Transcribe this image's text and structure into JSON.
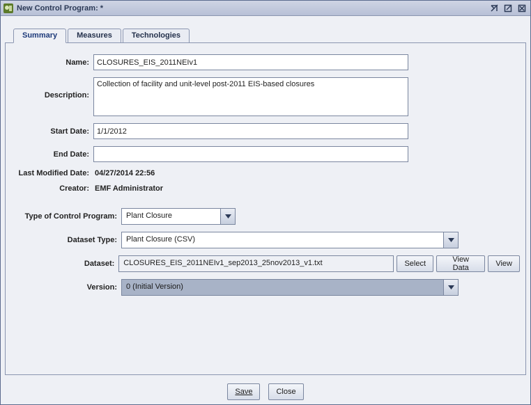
{
  "window": {
    "title": "New Control Program: *"
  },
  "tabs": [
    {
      "label": "Summary"
    },
    {
      "label": "Measures"
    },
    {
      "label": "Technologies"
    }
  ],
  "fields": {
    "name_label": "Name:",
    "name_value": "CLOSURES_EIS_2011NEIv1",
    "description_label": "Description:",
    "description_value": "Collection of facility and unit-level post-2011 EIS-based closures",
    "start_date_label": "Start Date:",
    "start_date_value": "1/1/2012",
    "end_date_label": "End Date:",
    "end_date_value": "",
    "last_mod_label": "Last Modified Date:",
    "last_mod_value": "04/27/2014 22:56",
    "creator_label": "Creator:",
    "creator_value": "EMF Administrator",
    "type_label": "Type of Control Program:",
    "type_value": "Plant Closure",
    "dataset_type_label": "Dataset Type:",
    "dataset_type_value": "Plant Closure (CSV)",
    "dataset_label": "Dataset:",
    "dataset_value": "CLOSURES_EIS_2011NEIv1_sep2013_25nov2013_v1.txt",
    "version_label": "Version:",
    "version_value": "0 (Initial Version)"
  },
  "buttons": {
    "select": "Select",
    "view_data": "View Data",
    "view": "View",
    "save": "Save",
    "close": "Close"
  }
}
